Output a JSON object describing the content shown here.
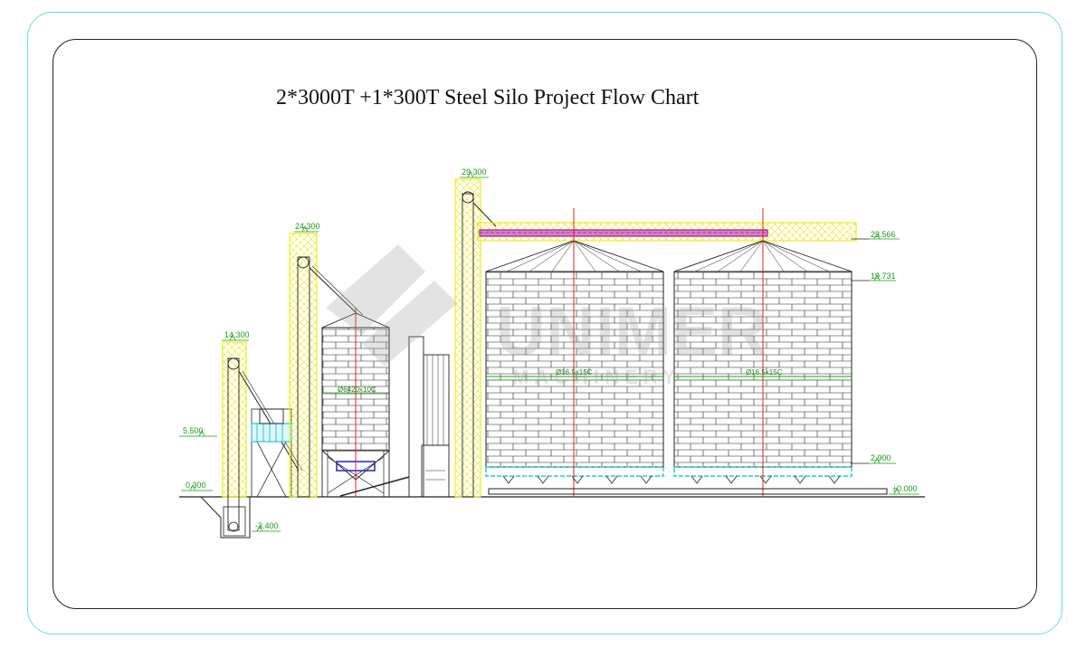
{
  "title": "2*3000T +1*300T Steel Silo Project Flow Chart",
  "watermark": {
    "brand": "UNIMER",
    "sub": "MACHINERY"
  },
  "elevations": {
    "e1": "29.300",
    "e2": "24.300",
    "e3": "23.566",
    "e4": "19.731",
    "e5": "14.300",
    "e6": "5.500",
    "e7": "0.300",
    "e8": "-3.400",
    "e9": "2.900",
    "e10": "±0.000"
  },
  "silos": {
    "small": {
      "diameter_label": "Ø6420x10C"
    },
    "large_left": {
      "diameter_label": "Ø16.5x15C"
    },
    "large_right": {
      "diameter_label": "Ø16.5x15C"
    }
  },
  "colors": {
    "frame": "#5fe3e0",
    "structure_yellow": "#e8e800",
    "level_green": "#1aa01a",
    "centerline_red": "#e02020",
    "conveyor_magenta": "#a0209a",
    "hopper_cyan": "#20c8e0"
  }
}
